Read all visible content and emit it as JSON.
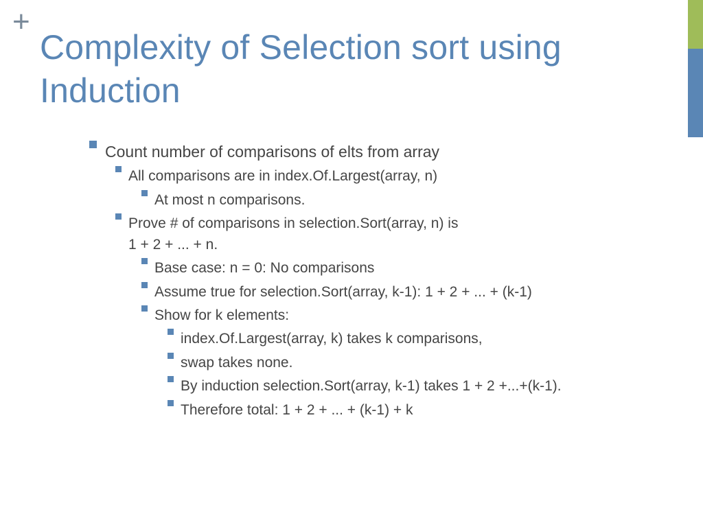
{
  "decor": {
    "plus": "+"
  },
  "title": "Complexity of Selection sort using Induction",
  "b1": "Count number of comparisons of elts from array",
  "b1_1": "All comparisons are in index.Of.Largest(array, n)",
  "b1_1_1": "At most n comparisons.",
  "b1_2": "Prove # of comparisons in selection.Sort(array, n) is",
  "b1_2c": "1 + 2 + ... + n.",
  "b1_2_1": "Base case: n = 0:  No comparisons",
  "b1_2_2": "Assume true for selection.Sort(array, k-1): 1 + 2 + ... + (k-1)",
  "b1_2_3": "Show for k elements:",
  "b1_2_3_1": "index.Of.Largest(array, k) takes k comparisons,",
  "b1_2_3_2": "swap takes none.",
  "b1_2_3_3": "By induction selection.Sort(array, k-1) takes 1 + 2 +...+(k-1).",
  "b1_2_3_4": "Therefore total: 1 + 2 + ... + (k-1) + k"
}
